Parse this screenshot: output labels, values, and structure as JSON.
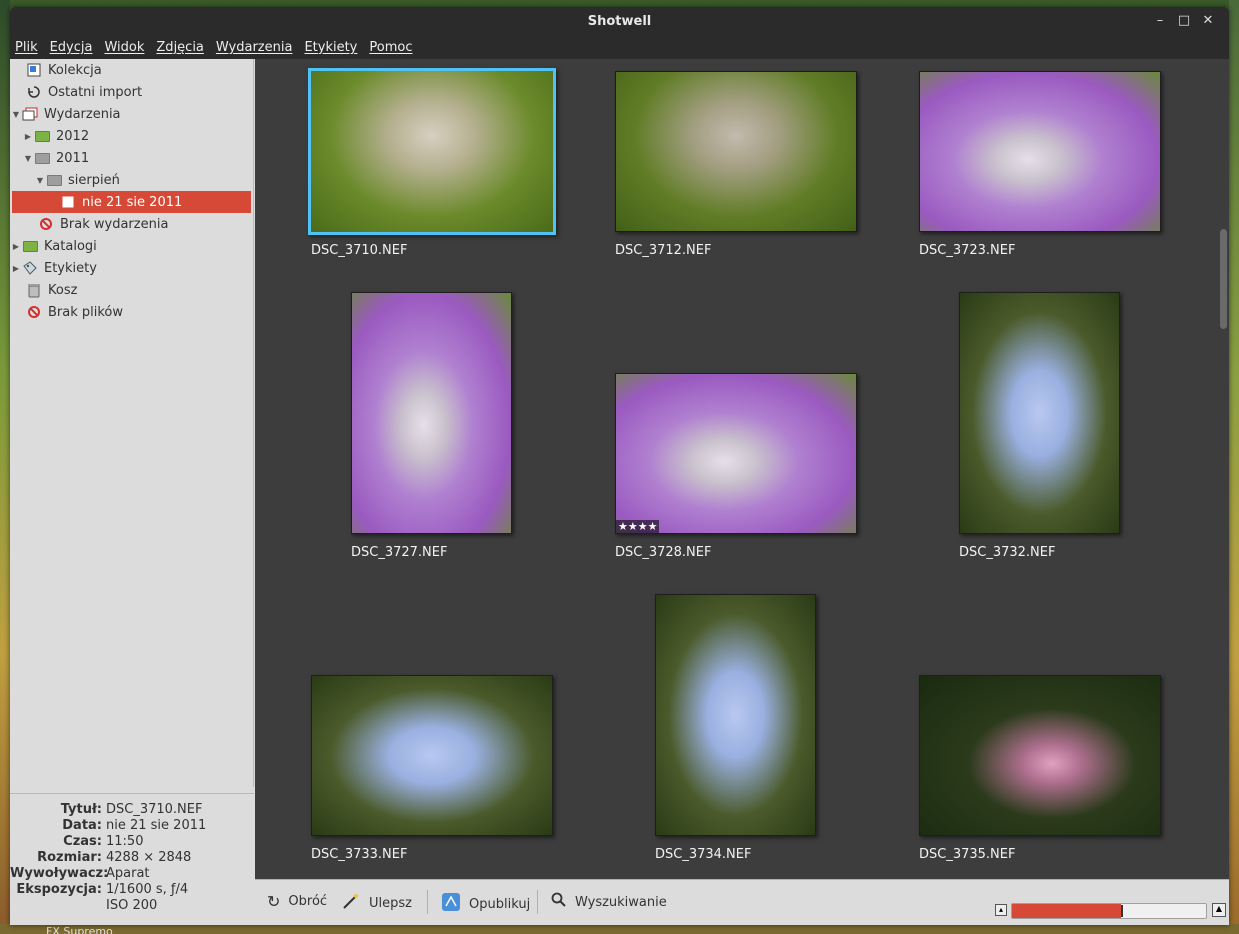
{
  "window": {
    "title": "Shotwell",
    "controls": {
      "minimize": "–",
      "maximize": "□",
      "close": "✕"
    }
  },
  "menubar": [
    "Plik",
    "Edycja",
    "Widok",
    "Zdjęcia",
    "Wydarzenia",
    "Etykiety",
    "Pomoc"
  ],
  "sidebar": {
    "items": [
      {
        "label": "Kolekcja",
        "icon": "collection-icon"
      },
      {
        "label": "Ostatni import",
        "icon": "import-icon"
      },
      {
        "label": "Wydarzenia",
        "icon": "events-icon",
        "expanded": true
      },
      {
        "label": "2012",
        "icon": "folder-green-icon",
        "expanded": false
      },
      {
        "label": "2011",
        "icon": "folder-grey-icon",
        "expanded": true
      },
      {
        "label": "sierpień",
        "icon": "folder-grey-icon",
        "expanded": true
      },
      {
        "label": "nie 21 sie 2011",
        "icon": "event-icon",
        "selected": true
      },
      {
        "label": "Brak wydarzenia",
        "icon": "no-event-icon"
      },
      {
        "label": "Katalogi",
        "icon": "folder-green-icon",
        "expanded": false
      },
      {
        "label": "Etykiety",
        "icon": "tags-icon",
        "expanded": false
      },
      {
        "label": "Kosz",
        "icon": "trash-icon"
      },
      {
        "label": "Brak plików",
        "icon": "missing-files-icon"
      }
    ]
  },
  "info": {
    "rows": [
      {
        "key": "Tytuł:",
        "value": "DSC_3710.NEF"
      },
      {
        "key": "Data:",
        "value": "nie 21 sie 2011"
      },
      {
        "key": "Czas:",
        "value": "11:50"
      },
      {
        "key": "Rozmiar:",
        "value": "4288 × 2848"
      },
      {
        "key": "Wywoływacz:",
        "value": "Aparat"
      },
      {
        "key": "Ekspozycja:",
        "value": "1/1600 s, ƒ/4"
      },
      {
        "key": "",
        "value": "ISO 200"
      }
    ]
  },
  "photos": [
    {
      "name": "DSC_3710.NEF",
      "subject": "grass",
      "orientation": "landscape",
      "selected": true
    },
    {
      "name": "DSC_3712.NEF",
      "subject": "grass",
      "orientation": "landscape"
    },
    {
      "name": "DSC_3723.NEF",
      "subject": "bell",
      "orientation": "landscape"
    },
    {
      "name": "DSC_3727.NEF",
      "subject": "bell",
      "orientation": "portrait"
    },
    {
      "name": "DSC_3728.NEF",
      "subject": "bell",
      "orientation": "landscape",
      "rating": 4,
      "rating_label": "★★★★"
    },
    {
      "name": "DSC_3732.NEF",
      "subject": "forget",
      "orientation": "portrait"
    },
    {
      "name": "DSC_3733.NEF",
      "subject": "forget",
      "orientation": "landscape"
    },
    {
      "name": "DSC_3734.NEF",
      "subject": "forget",
      "orientation": "portrait"
    },
    {
      "name": "DSC_3735.NEF",
      "subject": "pink",
      "orientation": "landscape"
    }
  ],
  "toolbar": {
    "rotate": "Obróć",
    "enhance": "Ulepsz",
    "publish": "Opublikuj",
    "search": "Wyszukiwanie",
    "zoom_level": 0.56
  },
  "desktop_label": "FX Supremo",
  "colors": {
    "accent": "#d64937",
    "selection": "#4fc3f7",
    "viewer_bg": "#3d3d3d"
  }
}
